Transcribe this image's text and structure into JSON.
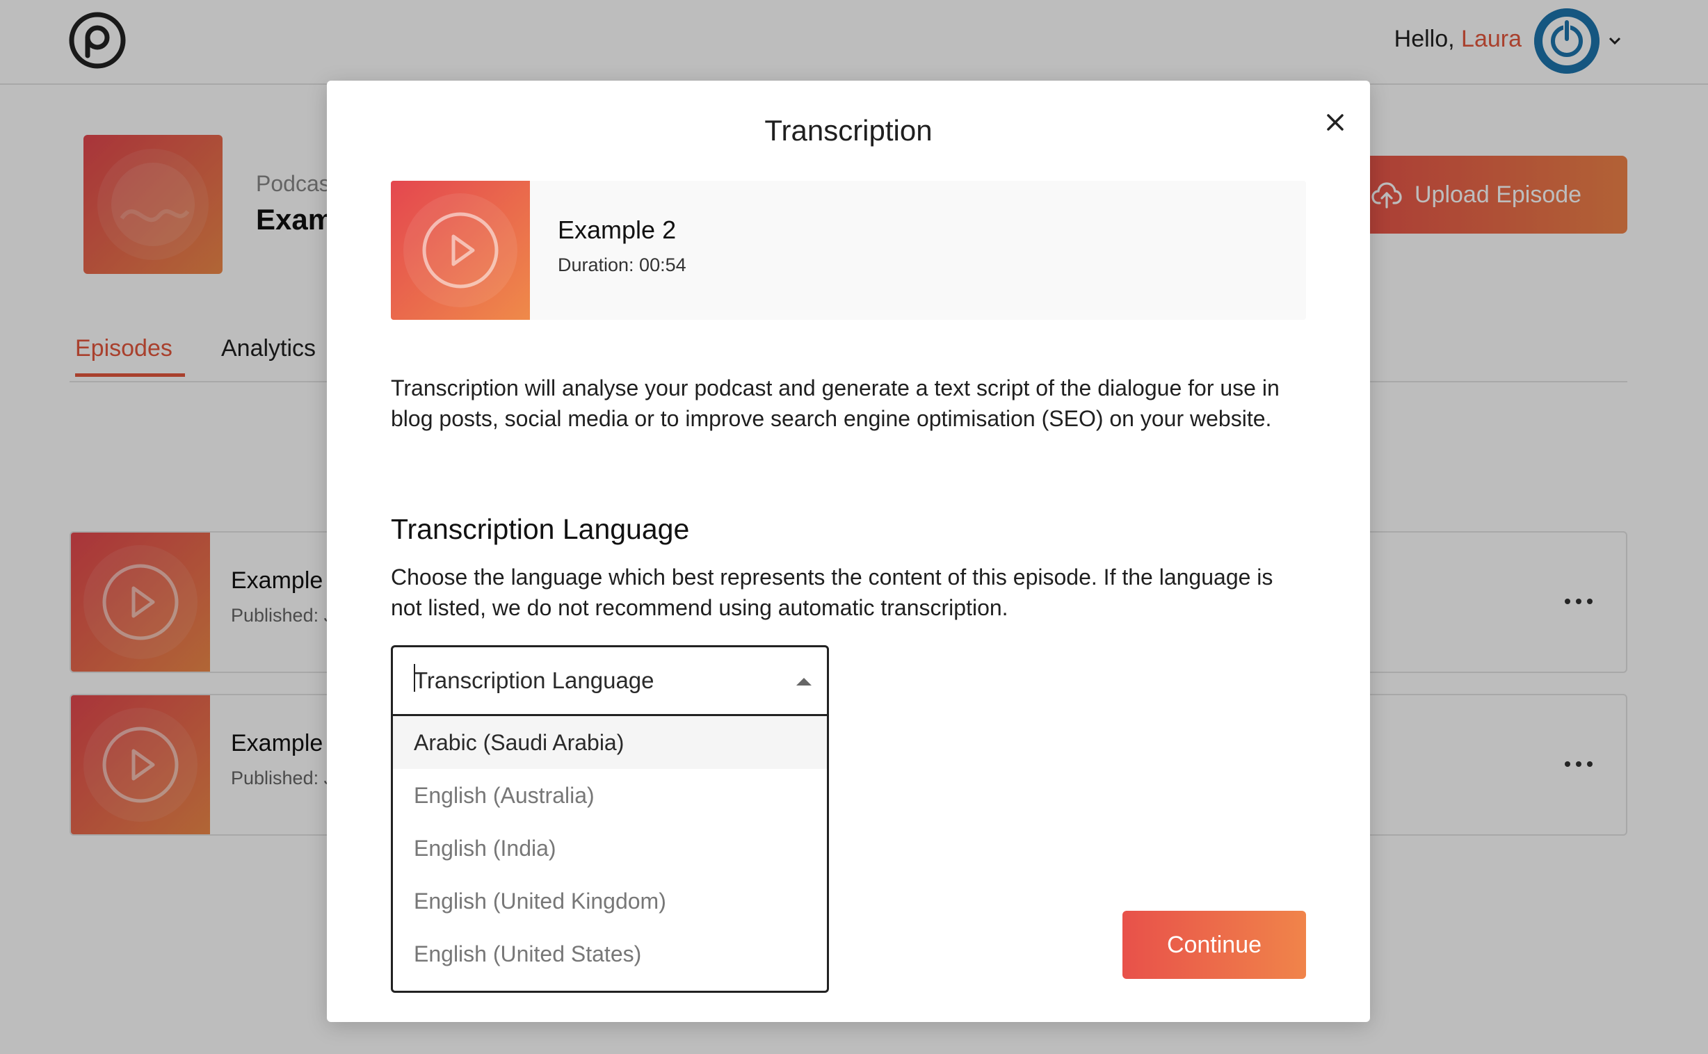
{
  "header": {
    "greeting_prefix": "Hello,",
    "user_name": "Laura",
    "brand_color": "#e4573d",
    "avatar_color": "#1d75ad"
  },
  "podcast": {
    "label": "Podcas",
    "title": "Exam"
  },
  "upload_button": {
    "label": "Upload Episode"
  },
  "tabs": [
    {
      "label": "Episodes",
      "active": true
    },
    {
      "label": "Analytics",
      "active": false
    }
  ],
  "episodes": [
    {
      "name": "Example",
      "meta": "Published: J"
    },
    {
      "name": "Example",
      "meta": "Published: J"
    }
  ],
  "modal": {
    "title": "Transcription",
    "episode": {
      "title": "Example 2",
      "duration": "Duration: 00:54"
    },
    "description": "Transcription will analyse your podcast and generate a text script of the dialogue for use in blog posts, social media or to improve search engine optimisation (SEO) on your website.",
    "language_section": {
      "title": "Transcription Language",
      "description": "Choose the language which best represents the content of this episode. If the language is not listed, we do not recommend using automatic transcription.",
      "select_placeholder": "Transcription Language",
      "value": "",
      "options": [
        "Arabic (Saudi Arabia)",
        "English (Australia)",
        "English (India)",
        "English (United Kingdom)",
        "English (United States)"
      ],
      "highlighted_option": "Arabic (Saudi Arabia)"
    },
    "continue_label": "Continue"
  }
}
